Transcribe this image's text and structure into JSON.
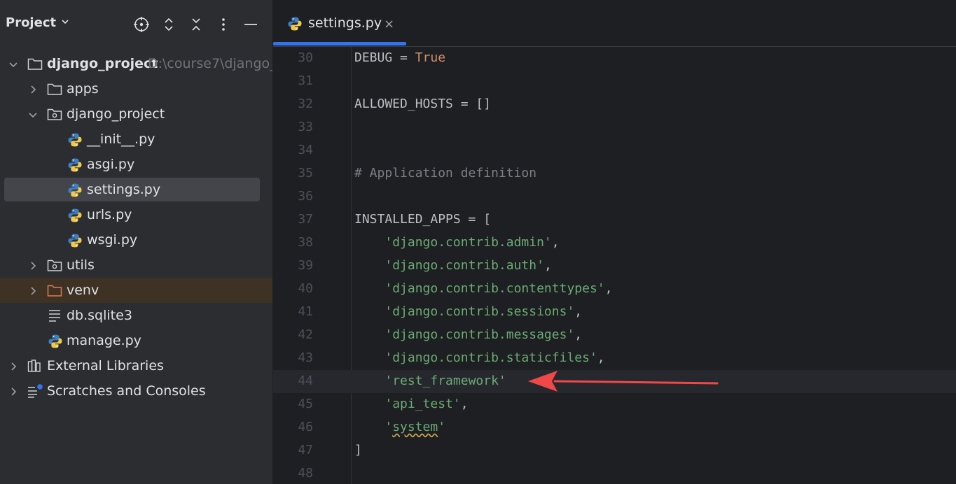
{
  "project_panel": {
    "title": "Project",
    "tools": [
      "crosshair-icon",
      "expand-icon",
      "collapse-icon",
      "more-icon",
      "minimize-icon"
    ],
    "tree": [
      {
        "label": "django_project",
        "path": "D:\\course7\\django_p",
        "type": "folder",
        "expanded": true,
        "bold": true
      },
      {
        "label": "apps",
        "type": "folder",
        "expanded": false
      },
      {
        "label": "django_project",
        "type": "package",
        "expanded": true
      },
      {
        "label": "__init__.py",
        "type": "python"
      },
      {
        "label": "asgi.py",
        "type": "python"
      },
      {
        "label": "settings.py",
        "type": "python",
        "selected": true
      },
      {
        "label": "urls.py",
        "type": "python"
      },
      {
        "label": "wsgi.py",
        "type": "python"
      },
      {
        "label": "utils",
        "type": "package",
        "expanded": false
      },
      {
        "label": "venv",
        "type": "excluded-folder",
        "expanded": false
      },
      {
        "label": "db.sqlite3",
        "type": "text"
      },
      {
        "label": "manage.py",
        "type": "python"
      },
      {
        "label": "External Libraries",
        "type": "library",
        "expanded": false
      },
      {
        "label": "Scratches and Consoles",
        "type": "scratches",
        "expanded": false
      }
    ]
  },
  "editor": {
    "tab": {
      "label": "settings.py",
      "close": "×"
    },
    "current_line": 44,
    "lines": [
      {
        "num": "30",
        "tokens": [
          {
            "t": "DEBUG = ",
            "c": "txt"
          },
          {
            "t": "True",
            "c": "kw"
          }
        ]
      },
      {
        "num": "31",
        "tokens": []
      },
      {
        "num": "32",
        "tokens": [
          {
            "t": "ALLOWED_HOSTS = []",
            "c": "txt"
          }
        ]
      },
      {
        "num": "33",
        "tokens": []
      },
      {
        "num": "34",
        "tokens": []
      },
      {
        "num": "35",
        "tokens": [
          {
            "t": "# Application definition",
            "c": "com"
          }
        ]
      },
      {
        "num": "36",
        "tokens": []
      },
      {
        "num": "37",
        "tokens": [
          {
            "t": "INSTALLED_APPS = [",
            "c": "txt"
          }
        ]
      },
      {
        "num": "38",
        "tokens": [
          {
            "t": "    ",
            "c": "txt"
          },
          {
            "t": "'django.contrib.admin'",
            "c": "str"
          },
          {
            "t": ",",
            "c": "txt"
          }
        ]
      },
      {
        "num": "39",
        "tokens": [
          {
            "t": "    ",
            "c": "txt"
          },
          {
            "t": "'django.contrib.auth'",
            "c": "str"
          },
          {
            "t": ",",
            "c": "txt"
          }
        ]
      },
      {
        "num": "40",
        "tokens": [
          {
            "t": "    ",
            "c": "txt"
          },
          {
            "t": "'django.contrib.contenttypes'",
            "c": "str"
          },
          {
            "t": ",",
            "c": "txt"
          }
        ]
      },
      {
        "num": "41",
        "tokens": [
          {
            "t": "    ",
            "c": "txt"
          },
          {
            "t": "'django.contrib.sessions'",
            "c": "str"
          },
          {
            "t": ",",
            "c": "txt"
          }
        ]
      },
      {
        "num": "42",
        "tokens": [
          {
            "t": "    ",
            "c": "txt"
          },
          {
            "t": "'django.contrib.messages'",
            "c": "str"
          },
          {
            "t": ",",
            "c": "txt"
          }
        ]
      },
      {
        "num": "43",
        "tokens": [
          {
            "t": "    ",
            "c": "txt"
          },
          {
            "t": "'django.contrib.staticfiles'",
            "c": "str"
          },
          {
            "t": ",",
            "c": "txt"
          }
        ]
      },
      {
        "num": "44",
        "tokens": [
          {
            "t": "    ",
            "c": "txt"
          },
          {
            "t": "'rest_framework'",
            "c": "str"
          }
        ]
      },
      {
        "num": "45",
        "tokens": [
          {
            "t": "    ",
            "c": "txt"
          },
          {
            "t": "'api_test'",
            "c": "str"
          },
          {
            "t": ",",
            "c": "txt"
          }
        ]
      },
      {
        "num": "46",
        "tokens": [
          {
            "t": "    ",
            "c": "txt"
          },
          {
            "t": "'",
            "c": "str"
          },
          {
            "t": "system",
            "c": "str",
            "squiggle": true
          },
          {
            "t": "'",
            "c": "str"
          }
        ]
      },
      {
        "num": "47",
        "tokens": [
          {
            "t": "]",
            "c": "txt"
          }
        ]
      },
      {
        "num": "48",
        "tokens": []
      }
    ]
  },
  "colors": {
    "annotation_arrow": "#f04848",
    "accent": "#3574f0"
  }
}
